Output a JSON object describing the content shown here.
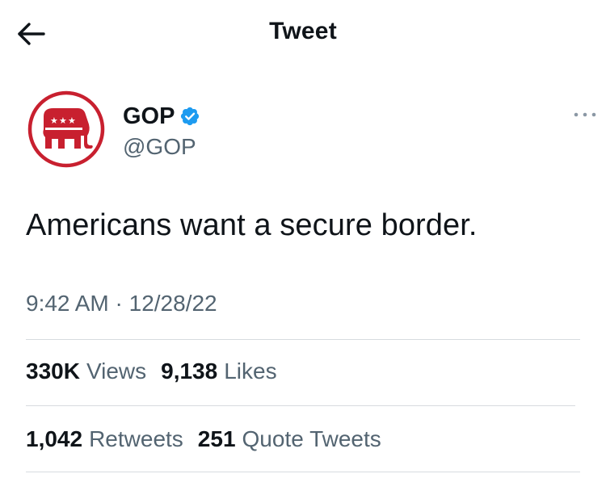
{
  "header": {
    "title": "Tweet",
    "back_icon": "arrow-left-icon"
  },
  "author": {
    "display_name": "GOP",
    "handle": "@GOP",
    "verified": true,
    "verified_color": "#1d9bf0",
    "avatar_icon": "republican-elephant-logo",
    "avatar_color": "#c8202f"
  },
  "tweet": {
    "text": "Americans want a secure border.",
    "time": "9:42 AM",
    "separator": "·",
    "date": "12/28/22"
  },
  "stats_row_1": {
    "views_count": "330K",
    "views_label": "Views",
    "likes_count": "9,138",
    "likes_label": "Likes"
  },
  "stats_row_2": {
    "retweets_count": "1,042",
    "retweets_label": "Retweets",
    "quotes_count": "251",
    "quotes_label": "Quote Tweets"
  },
  "colors": {
    "text_primary": "#0f1419",
    "text_secondary": "#536471",
    "divider": "#d7dbdf"
  }
}
